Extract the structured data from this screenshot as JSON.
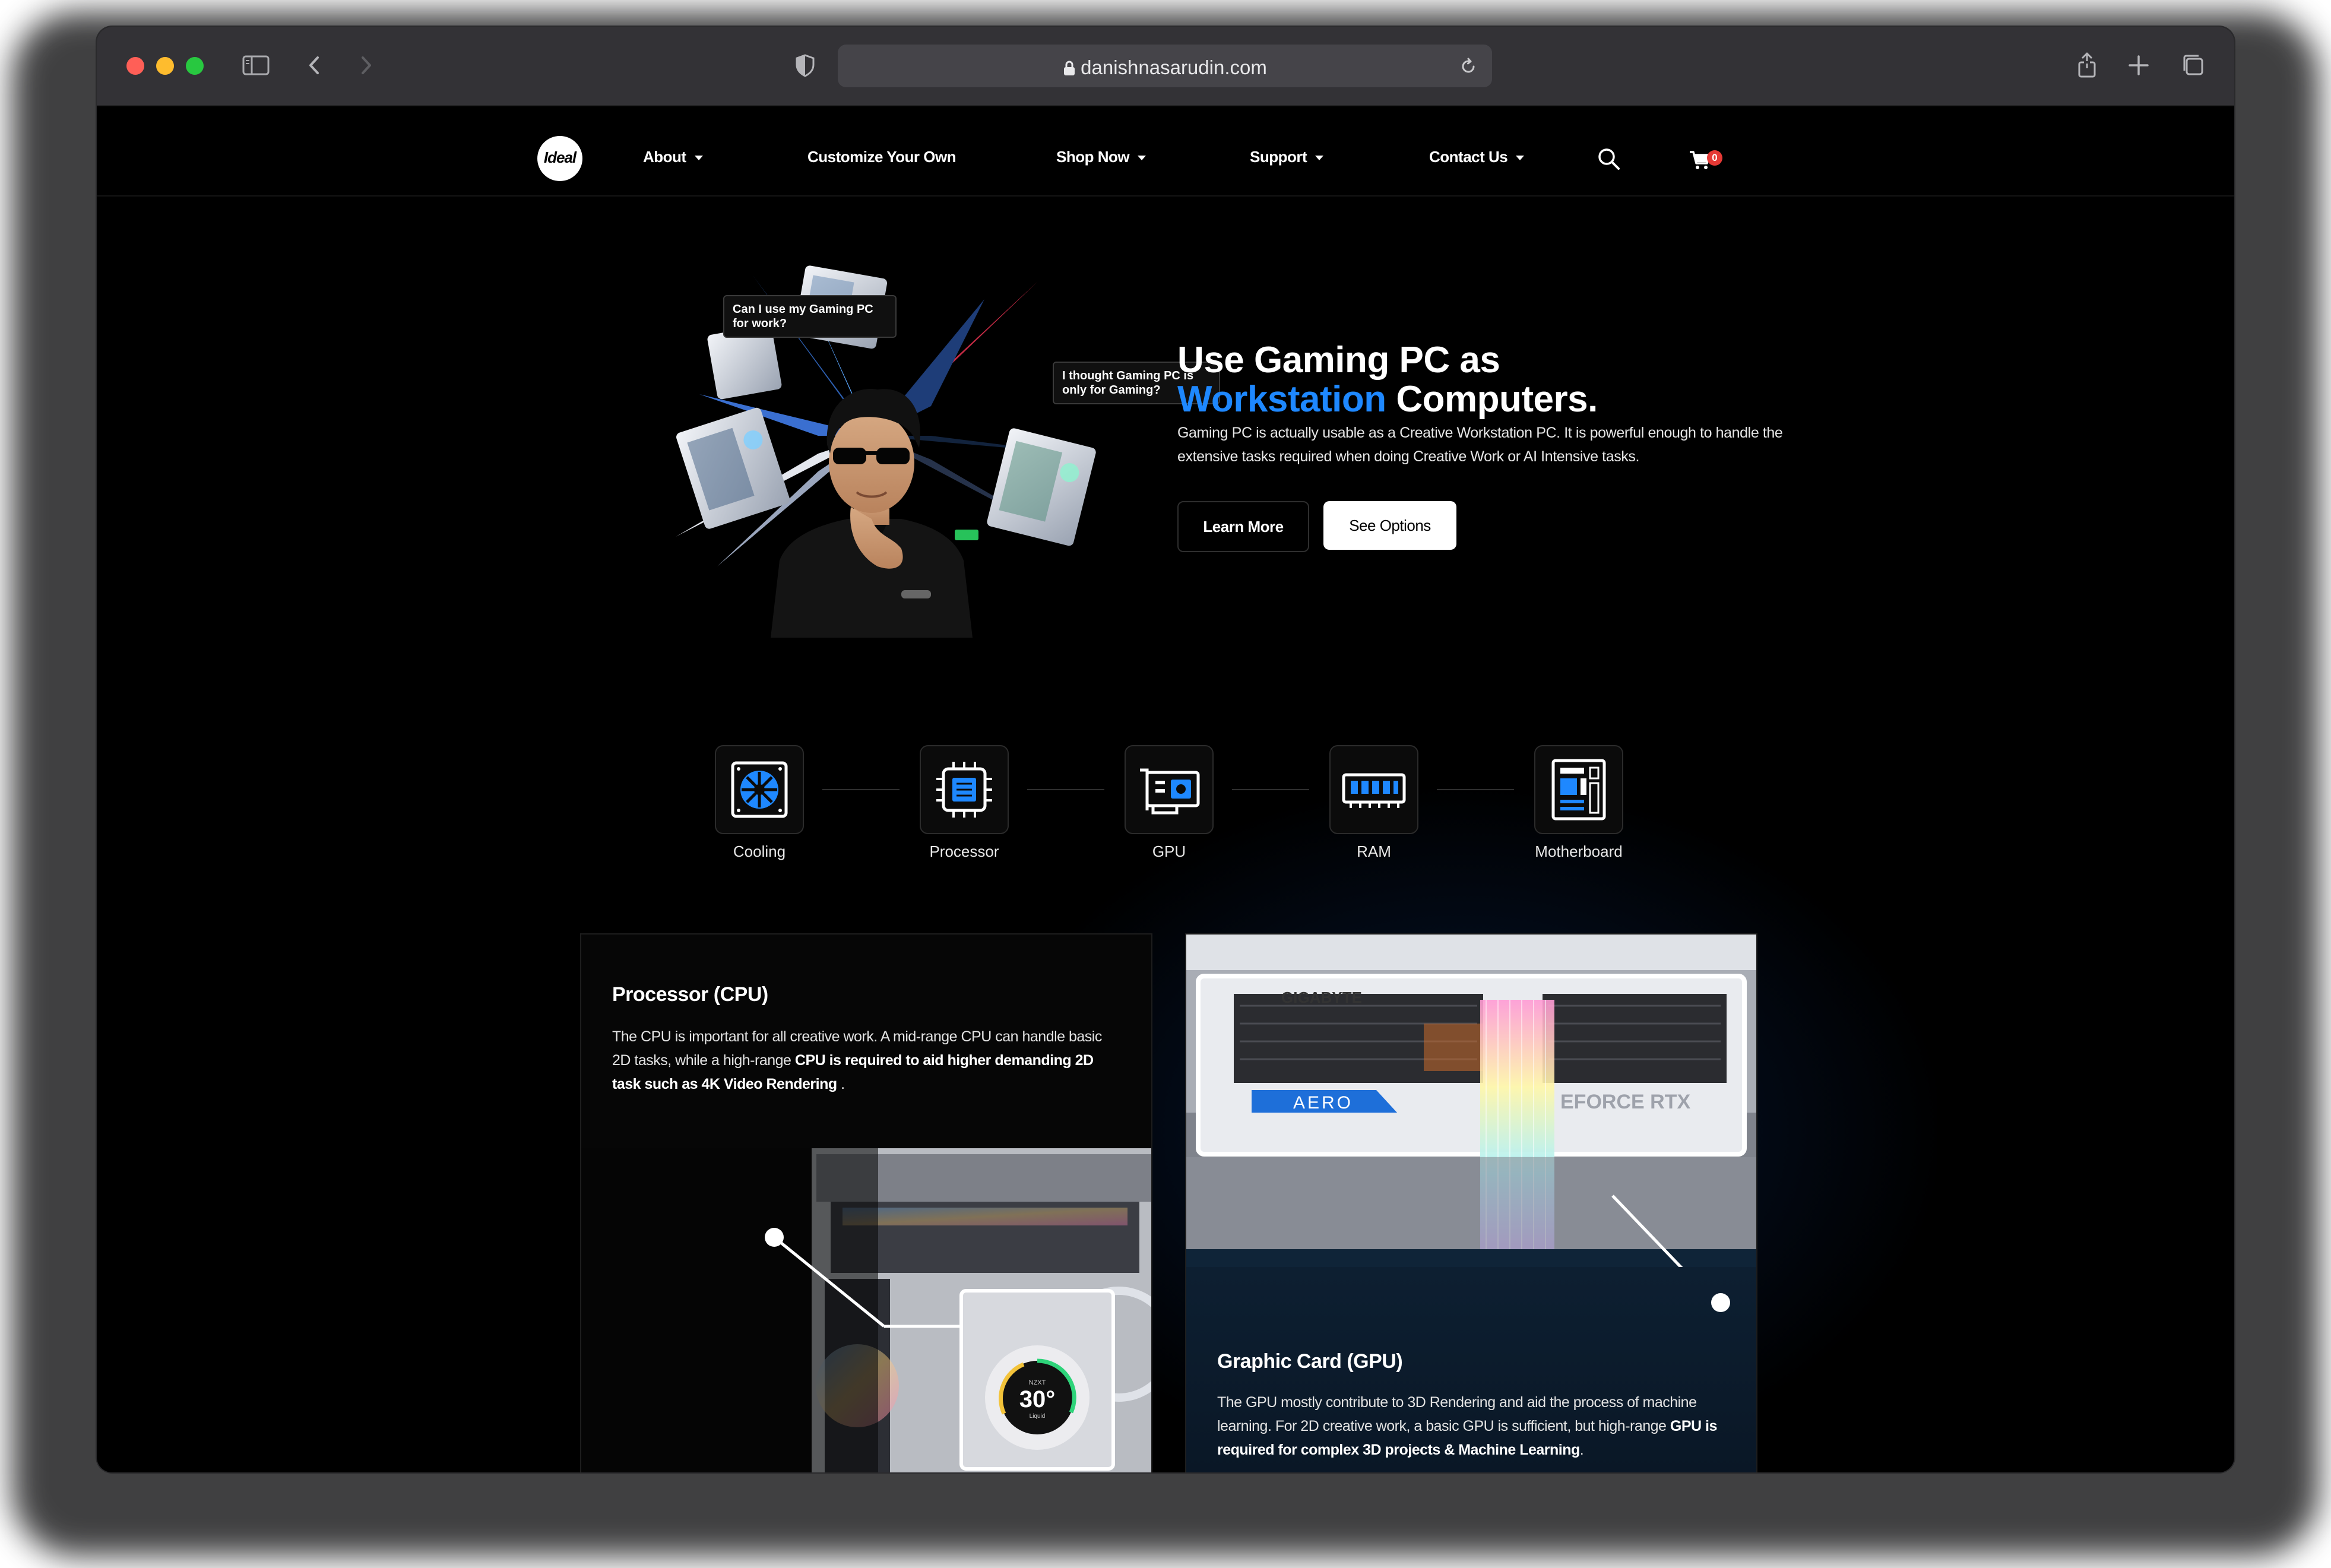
{
  "browser": {
    "url": "danishnasarudin.com"
  },
  "nav": {
    "logo_text": "Ideal",
    "items": [
      {
        "label": "About",
        "has_dropdown": true
      },
      {
        "label": "Customize Your Own",
        "has_dropdown": false
      },
      {
        "label": "Shop Now",
        "has_dropdown": true
      },
      {
        "label": "Support",
        "has_dropdown": true
      },
      {
        "label": "Contact Us",
        "has_dropdown": true
      }
    ],
    "cart_count": "0",
    "icons": [
      "search-icon",
      "cart-icon"
    ]
  },
  "hero": {
    "title_line1": "Use Gaming PC as",
    "title_highlight": "Workstation",
    "title_line2_rest": " Computers.",
    "description": "Gaming PC is actually usable as a Creative Workstation PC. It is powerful enough to handle the extensive tasks required when doing Creative Work or AI Intensive tasks.",
    "learn_more_label": "Learn More",
    "see_options_label": "See Options",
    "bubble_left": "Can I use my Gaming PC for work?",
    "bubble_right": "I thought Gaming PC is only for Gaming?",
    "accent_color": "#1e88ff"
  },
  "components": [
    {
      "label": "Cooling",
      "icon": "cooling-icon"
    },
    {
      "label": "Processor",
      "icon": "processor-icon"
    },
    {
      "label": "GPU",
      "icon": "gpu-icon"
    },
    {
      "label": "RAM",
      "icon": "ram-icon"
    },
    {
      "label": "Motherboard",
      "icon": "motherboard-icon"
    }
  ],
  "cpu_card": {
    "title": "Processor (CPU)",
    "text_plain": "The CPU is important for all creative work. A mid-range CPU can handle basic 2D tasks, while a high-range ",
    "text_bold": "CPU is required to aid higher demanding 2D task such as 4K Video Rendering",
    "text_end": " .",
    "cooler_reading": "30°",
    "cooler_brand": "NZXT",
    "cooler_sub": "Liquid"
  },
  "gpu_card": {
    "title": "Graphic Card (GPU)",
    "text_plain": "The GPU mostly contribute to 3D Rendering and aid the process of machine learning. For 2D creative work, a basic GPU is sufficient, but high-range ",
    "text_bold": "GPU is required for complex 3D projects & Machine Learning",
    "text_end": ".",
    "gpu_brand": "GIGABYTE",
    "gpu_badge": "AERO",
    "gpu_model": "EFORCE RTX"
  }
}
